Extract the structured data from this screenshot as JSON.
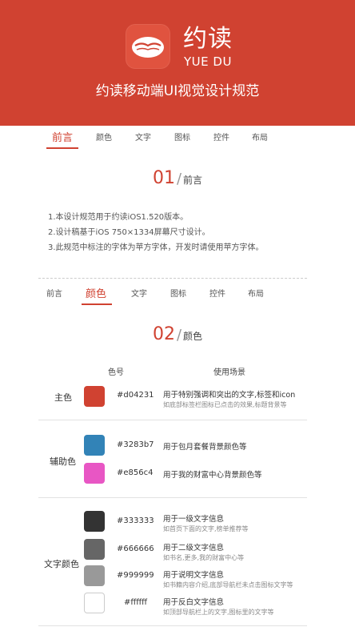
{
  "header": {
    "logo_title": "约读",
    "logo_subtitle": "YUE DU",
    "title": "约读移动端UI视觉设计规范",
    "bg_color": "#d04231"
  },
  "nav": {
    "tabs": [
      "前言",
      "颜色",
      "文字",
      "图标",
      "控件",
      "布局"
    ]
  },
  "section1": {
    "number": "01",
    "slash": "/",
    "name": "前言",
    "lines": [
      "1.本设计规范用于约读iOS1.520版本。",
      "2.设计稿基于iOS 750×1334屏幕尺寸设计。",
      "3.此规范中标注的字体为苹方字体，开发时请使用苹方字体。"
    ]
  },
  "section2": {
    "number": "02",
    "slash": "/",
    "name": "颜色",
    "col_color": "色号",
    "col_usage": "使用场景",
    "groups": {
      "primary": {
        "label": "主色",
        "items": [
          {
            "hex": "#d04231",
            "color": "#d04231",
            "usage": "用于特别强调和突出的文字,标签和icon",
            "note": "如底部标签栏图标已点击的效果,标题背景等"
          }
        ]
      },
      "secondary": {
        "label": "辅助色",
        "items": [
          {
            "hex": "#3283b7",
            "color": "#3283b7",
            "usage": "用于包月套餐背景颜色等",
            "note": ""
          },
          {
            "hex": "#e856c4",
            "color": "#e856c4",
            "usage": "用于我的财富中心背景颜色等",
            "note": ""
          }
        ]
      },
      "text": {
        "label": "文字颜色",
        "items": [
          {
            "hex": "#333333",
            "color": "#333333",
            "usage": "用于一级文字信息",
            "note": "如首页下面的文字,榜单推荐等"
          },
          {
            "hex": "#666666",
            "color": "#666666",
            "usage": "用于二级文字信息",
            "note": "如书名,更多,我的财富中心等"
          },
          {
            "hex": "#999999",
            "color": "#999999",
            "usage": "用于说明文字信息",
            "note": "如书籍内容介绍,底部导航栏未点击图标文字等"
          },
          {
            "hex": "#ffffff",
            "color": "#ffffff",
            "usage": "用于反白文字信息",
            "note": "如顶部导航栏上的文字,图标里的文字等"
          }
        ]
      }
    }
  }
}
